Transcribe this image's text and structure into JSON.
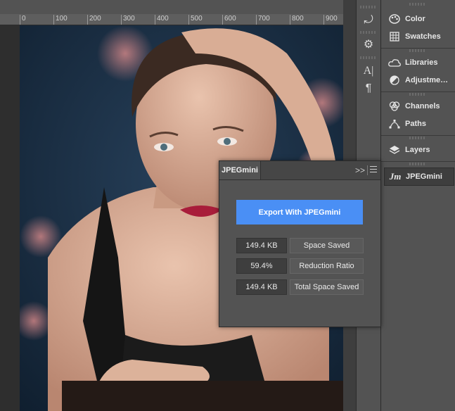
{
  "ruler": {
    "ticks": [
      "0",
      "100",
      "200",
      "300",
      "400",
      "500",
      "600",
      "700",
      "800",
      "900"
    ]
  },
  "toolstrip": {
    "tools": [
      {
        "icon": "history-icon",
        "glyph": "⤾"
      },
      {
        "icon": "properties-icon",
        "glyph": "⚙"
      },
      {
        "icon": "character-icon",
        "glyph": "A|"
      },
      {
        "icon": "paragraph-icon",
        "glyph": "¶"
      }
    ]
  },
  "dock": {
    "items": [
      {
        "label": "Color",
        "icon": "color-palette-icon"
      },
      {
        "label": "Swatches",
        "icon": "swatches-grid-icon"
      },
      {
        "label": "Libraries",
        "icon": "libraries-icon"
      },
      {
        "label": "Adjustment…",
        "icon": "adjustments-icon"
      },
      {
        "label": "Channels",
        "icon": "channels-icon"
      },
      {
        "label": "Paths",
        "icon": "paths-icon"
      },
      {
        "label": "Layers",
        "icon": "layers-icon"
      },
      {
        "label": "JPEGmini",
        "icon": "jpegmini-logo-icon",
        "glyph": "Jm",
        "active": true
      }
    ]
  },
  "jpegmini": {
    "tab": "JPEGmini",
    "collapse_glyph": ">>",
    "export_label": "Export With JPEGmini",
    "stats": [
      {
        "value": "149.4 KB",
        "label": "Space Saved"
      },
      {
        "value": "59.4%",
        "label": "Reduction Ratio"
      },
      {
        "value": "149.4 KB",
        "label": "Total Space Saved"
      }
    ]
  },
  "colors": {
    "accent": "#4a8ff5",
    "panel": "#535353",
    "panel_dark": "#3e3e3e",
    "canvas_bg": "#1b2e41"
  }
}
